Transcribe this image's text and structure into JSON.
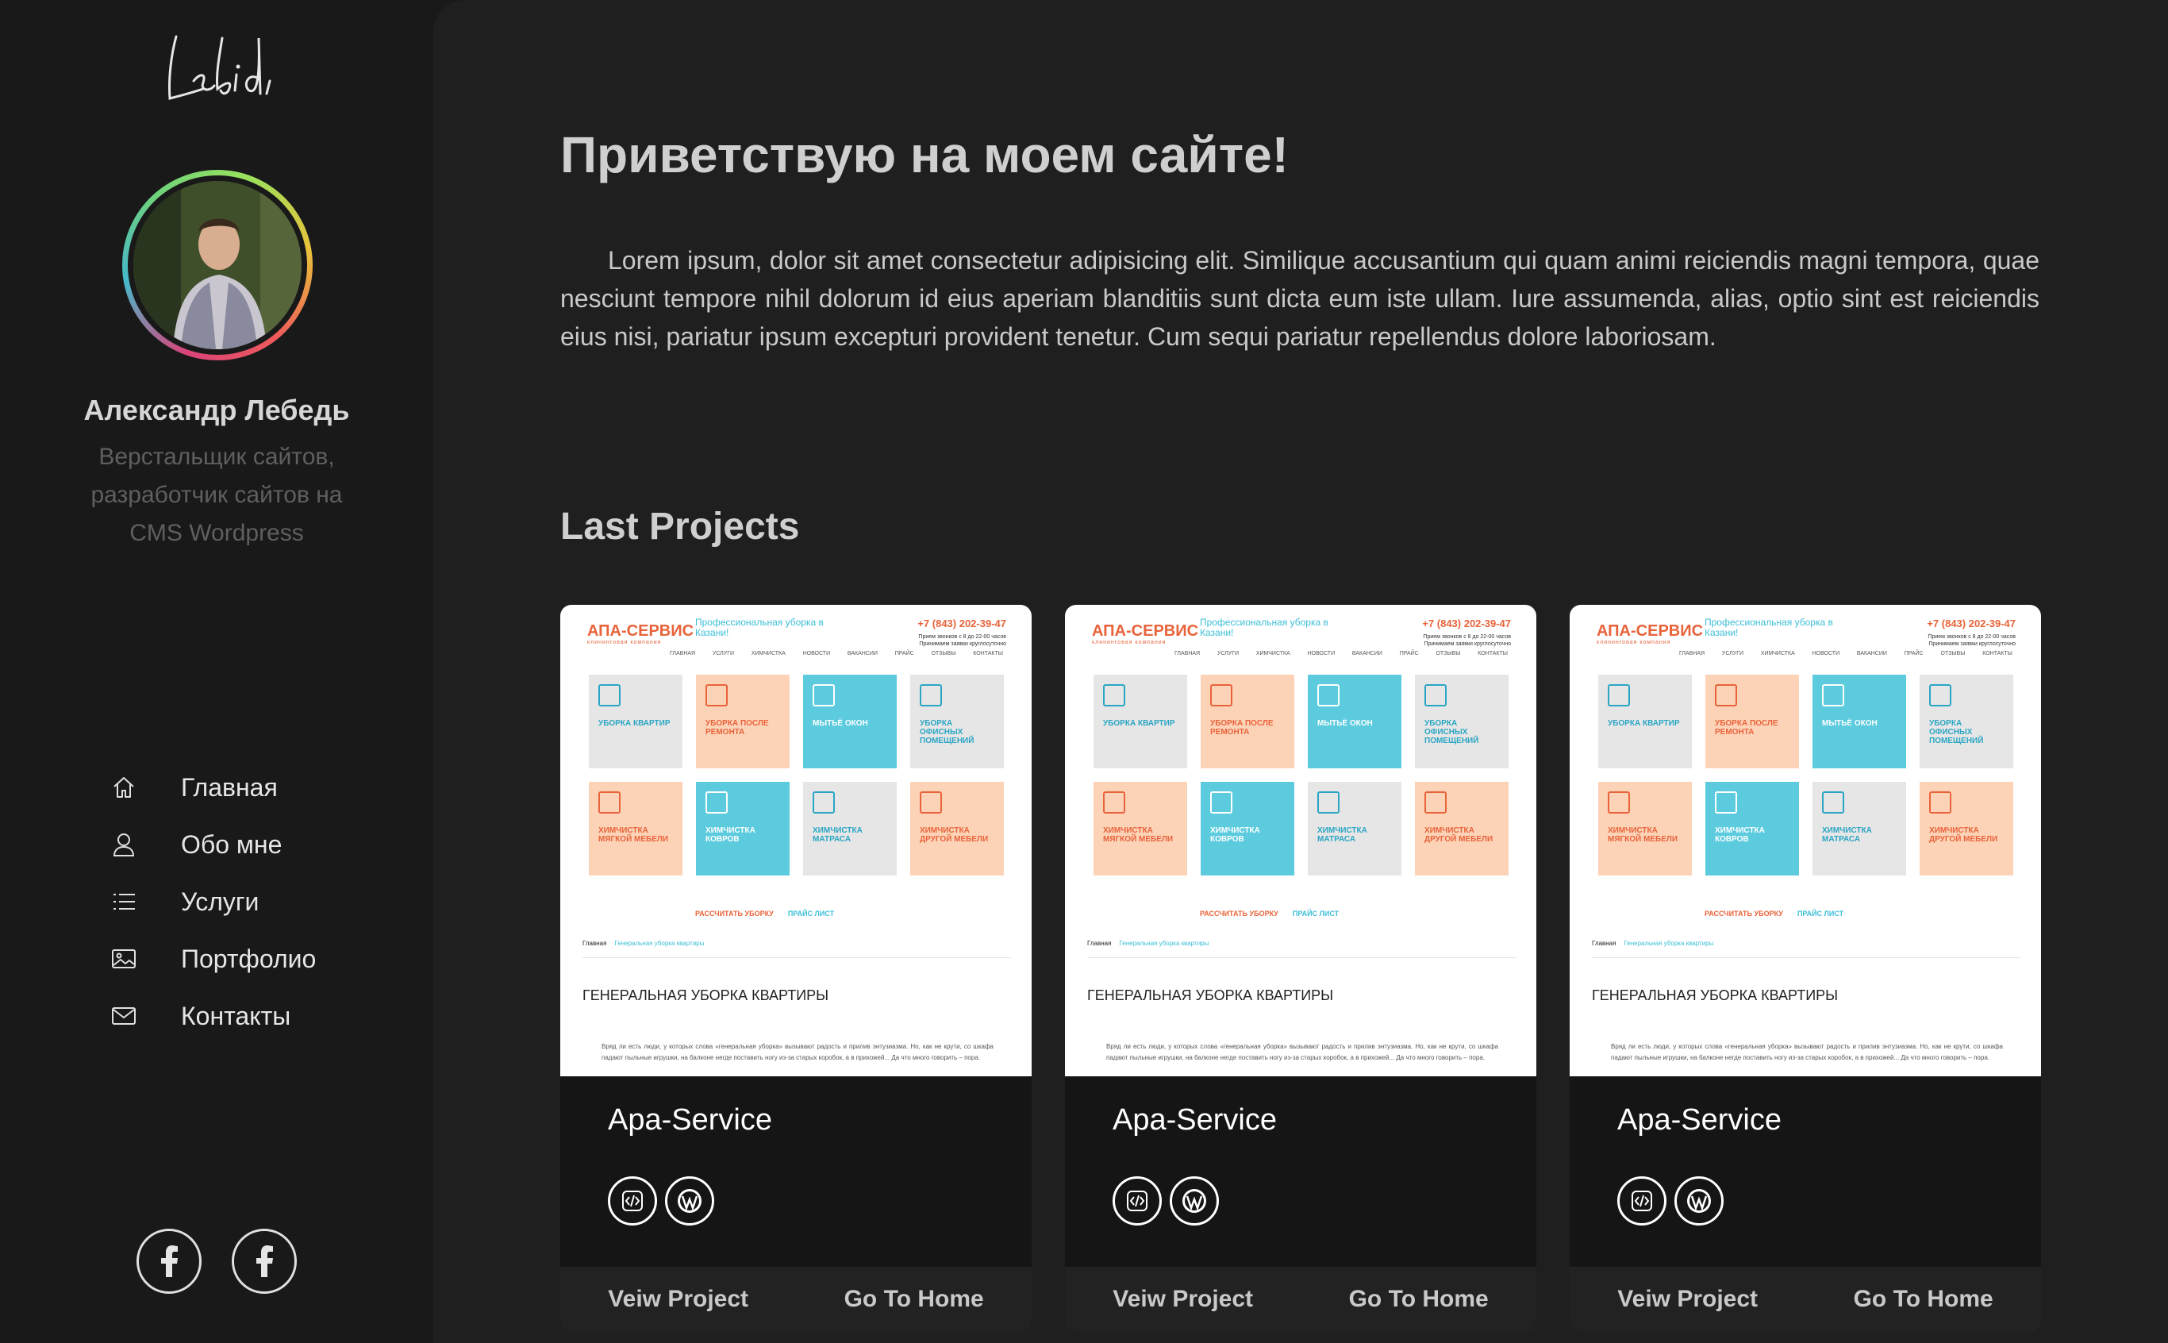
{
  "sidebar": {
    "logo_text": "Lebid.",
    "profile": {
      "name": "Александр Лебедь",
      "role": "Верстальщик сайтов, разработчик сайтов на CMS Wordpress"
    },
    "nav": [
      {
        "label": "Главная",
        "icon": "home-icon"
      },
      {
        "label": "Обо мне",
        "icon": "user-icon"
      },
      {
        "label": "Услуги",
        "icon": "list-icon"
      },
      {
        "label": "Портфолио",
        "icon": "image-icon"
      },
      {
        "label": "Контакты",
        "icon": "mail-icon"
      }
    ],
    "socials": [
      {
        "icon": "facebook-icon"
      },
      {
        "icon": "facebook-icon"
      }
    ]
  },
  "main": {
    "welcome_title": "Приветствую на моем сайте!",
    "intro": "Lorem ipsum, dolor sit amet consectetur adipisicing elit. Similique accusantium qui quam animi reiciendis magni tempora, quae nesciunt tempore nihil dolorum id eius aperiam blanditiis sunt dicta eum iste ullam. Iure assumenda, alias, optio sint est reiciendis eius nisi, pariatur ipsum excepturi provident tenetur. Cum sequi pariatur repellendus dolore laboriosam.",
    "projects_title": "Last Projects",
    "projects": [
      {
        "title": "Apa-Service",
        "view_label": "Veiw Project",
        "home_label": "Go To Home",
        "tech": [
          "code-icon",
          "wordpress-icon"
        ]
      },
      {
        "title": "Apa-Service",
        "view_label": "Veiw Project",
        "home_label": "Go To Home",
        "tech": [
          "code-icon",
          "wordpress-icon"
        ]
      },
      {
        "title": "Apa-Service",
        "view_label": "Veiw Project",
        "home_label": "Go To Home",
        "tech": [
          "code-icon",
          "wordpress-icon"
        ]
      }
    ]
  },
  "preview": {
    "brand": "АПА-СЕРВИС",
    "brand_sub": "клининговая компания",
    "tagline": "Профессиональная уборка в Казани!",
    "phone": "+7 (843) 202-39-47",
    "phone_sub": "Прием звонков с 8 до 22-00 часов Принимаем заявки круглосуточно",
    "menu": [
      "ГЛАВНАЯ",
      "УСЛУГИ",
      "ХИМЧИСТКА",
      "НОВОСТИ",
      "ВАКАНСИИ",
      "ПРАЙС",
      "ОТЗЫВЫ",
      "КОНТАКТЫ"
    ],
    "tiles": [
      {
        "label": "УБОРКА КВАРТИР",
        "color": "#e6e6e6",
        "text_color": "#2aa6c4"
      },
      {
        "label": "УБОРКА ПОСЛЕ РЕМОНТА",
        "color": "#fdd3b8",
        "text_color": "#e8633a"
      },
      {
        "label": "МЫТЬЁ ОКОН",
        "color": "#5ccbde",
        "text_color": "#ffffff"
      },
      {
        "label": "УБОРКА ОФИСНЫХ ПОМЕЩЕНИЙ",
        "color": "#e6e6e6",
        "text_color": "#2aa6c4"
      },
      {
        "label": "ХИМЧИСТКА МЯГКОЙ МЕБЕЛИ",
        "color": "#fdd3b8",
        "text_color": "#e8633a"
      },
      {
        "label": "ХИМЧИСТКА КОВРОВ",
        "color": "#5ccbde",
        "text_color": "#ffffff"
      },
      {
        "label": "ХИМЧИСТКА МАТРАСА",
        "color": "#e6e6e6",
        "text_color": "#2aa6c4"
      },
      {
        "label": "ХИМЧИСТКА ДРУГОЙ МЕБЕЛИ",
        "color": "#fdd3b8",
        "text_color": "#e8633a"
      }
    ],
    "action_calc": "РАССЧИТАТЬ УБОРКУ",
    "action_price": "ПРАЙС ЛИСТ",
    "crumb_home": "Главная",
    "crumb_current": "Генеральная уборка квартиры",
    "heading": "ГЕНЕРАЛЬНАЯ УБОРКА КВАРТИРЫ",
    "text": "Вряд ли есть люди, у которых слова «генеральная уборка» вызывают радость и прилив энтузиазма. Но, как не крути, со шкафа падают пыльные игрушки, на балконе негде поставить ногу из-за старых коробок, а в прихожей... Да что много говорить – пора."
  },
  "colors": {
    "accent_orange": "#e8633a",
    "accent_cyan": "#3bbfd6",
    "sidebar_bg": "#191919",
    "panel_bg": "#1f1f1f"
  }
}
